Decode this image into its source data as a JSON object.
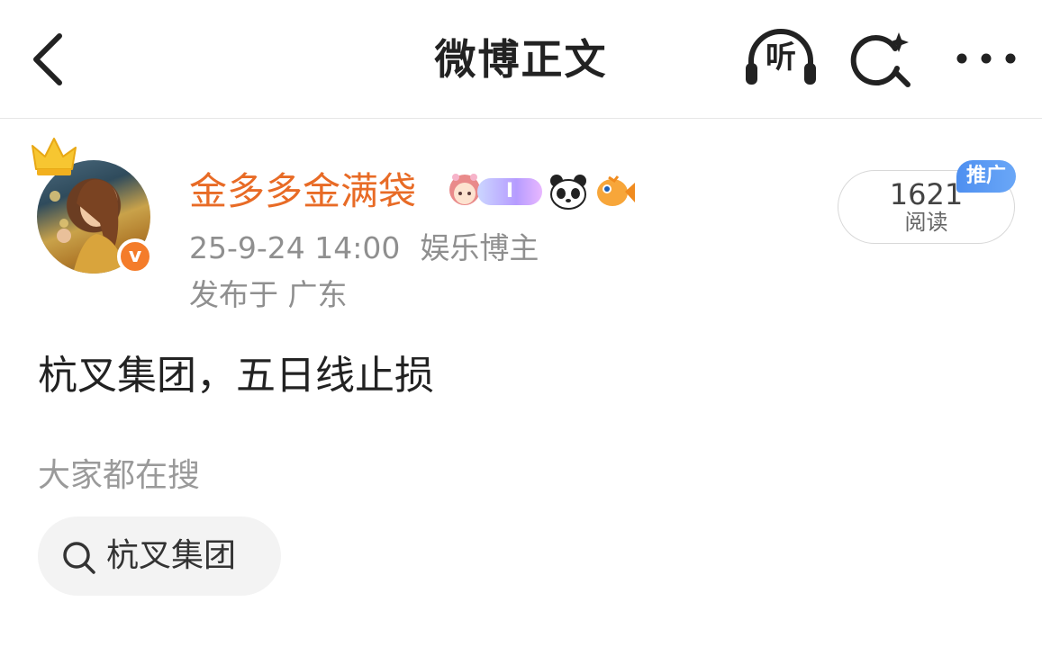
{
  "header": {
    "title": "微博正文",
    "listen_label": "听",
    "icons": {
      "back": "back-chevron-icon",
      "listen": "headphones-icon",
      "search": "search-sparkle-icon",
      "more": "more-dots-icon"
    }
  },
  "author": {
    "name": "金多多金满袋",
    "verified_mark": "v",
    "avatar": "avatar-image",
    "crown": "crown-icon",
    "badges": {
      "girl": "girl-face-badge-icon",
      "level": "I",
      "panda": "panda-badge-icon",
      "fish": "fish-badge-icon"
    }
  },
  "post": {
    "timestamp": "25-9-24 14:00",
    "role": "娱乐博主",
    "location": "发布于 广东",
    "text": "杭叉集团，五日线止损"
  },
  "read_counter": {
    "count": "1621",
    "label": "阅读",
    "promo_tag": "推广"
  },
  "trending": {
    "label": "大家都在搜",
    "chip_text": "杭叉集团"
  },
  "colors": {
    "author_name": "#e86b26",
    "verified_badge": "#f47c2a",
    "promo_tag": "#4e8ff0",
    "meta_text": "#8f8f8f"
  }
}
